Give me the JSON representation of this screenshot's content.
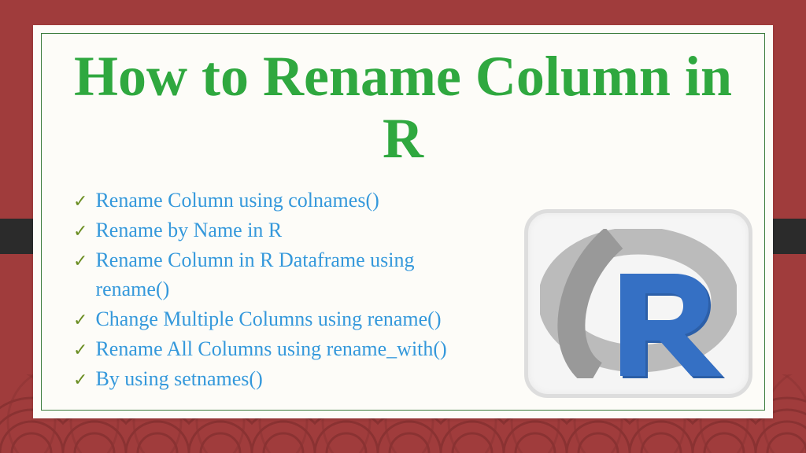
{
  "title": "How to Rename Column in R",
  "bullets": [
    "Rename Column using colnames()",
    "Rename by Name in R",
    "Rename Column in R Dataframe using rename()",
    "Change Multiple Columns using rename()",
    "Rename All Columns using rename_with()",
    "By using setnames()"
  ]
}
